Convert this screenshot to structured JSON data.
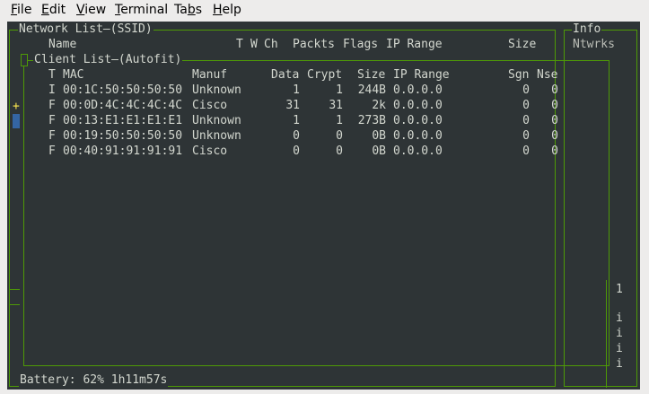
{
  "menu": [
    {
      "pre": "",
      "u": "F",
      "post": "ile"
    },
    {
      "pre": "",
      "u": "E",
      "post": "dit"
    },
    {
      "pre": "",
      "u": "V",
      "post": "iew"
    },
    {
      "pre": "",
      "u": "T",
      "post": "erminal"
    },
    {
      "pre": "Ta",
      "u": "b",
      "post": "s"
    },
    {
      "pre": "",
      "u": "H",
      "post": "elp"
    }
  ],
  "network_panel": {
    "title": "Network List",
    "sort": "(SSID)",
    "headers": {
      "name": "Name",
      "t": "T",
      "w": "W",
      "ch": "Ch",
      "packts": "Packts",
      "flags": "Flags",
      "ip_range": "IP Range",
      "size": "Size"
    }
  },
  "info_panel": {
    "title": "Info",
    "ntwrks": "Ntwrks",
    "count": "1",
    "side_markers": [
      "i",
      "i",
      "i",
      "i"
    ]
  },
  "client_panel": {
    "title": "Client List",
    "sort": "(Autofit)",
    "headers": {
      "t": "T",
      "mac": "MAC",
      "manuf": "Manuf",
      "data": "Data",
      "crypt": "Crypt",
      "size": "Size",
      "ip_range": "IP Range",
      "sgn": "Sgn",
      "nse": "Nse"
    },
    "rows": [
      {
        "t": "I",
        "mac": "00:1C:50:50:50:50",
        "manuf": "Unknown",
        "data": "1",
        "crypt": "1",
        "size": "244B",
        "ip": "0.0.0.0",
        "sgn": "0",
        "nse": "0"
      },
      {
        "t": "F",
        "mac": "00:0D:4C:4C:4C:4C",
        "manuf": "Cisco",
        "data": "31",
        "crypt": "31",
        "size": "2k",
        "ip": "0.0.0.0",
        "sgn": "0",
        "nse": "0"
      },
      {
        "t": "F",
        "mac": "00:13:E1:E1:E1:E1",
        "manuf": "Unknown",
        "data": "1",
        "crypt": "1",
        "size": "273B",
        "ip": "0.0.0.0",
        "sgn": "0",
        "nse": "0"
      },
      {
        "t": "F",
        "mac": "00:19:50:50:50:50",
        "manuf": "Unknown",
        "data": "0",
        "crypt": "0",
        "size": "0B",
        "ip": "0.0.0.0",
        "sgn": "0",
        "nse": "0"
      },
      {
        "t": "F",
        "mac": "00:40:91:91:91:91",
        "manuf": "Cisco",
        "data": "0",
        "crypt": "0",
        "size": "0B",
        "ip": "0.0.0.0",
        "sgn": "0",
        "nse": "0"
      }
    ]
  },
  "status": {
    "marker": "+",
    "battery": "Battery: 62% 1h11m57s"
  },
  "colors": {
    "terminal_bg": "#2e3436",
    "border": "#4e9a06",
    "text": "#d3d7cf",
    "marker": "#fce94f",
    "selection": "#3465a4"
  }
}
